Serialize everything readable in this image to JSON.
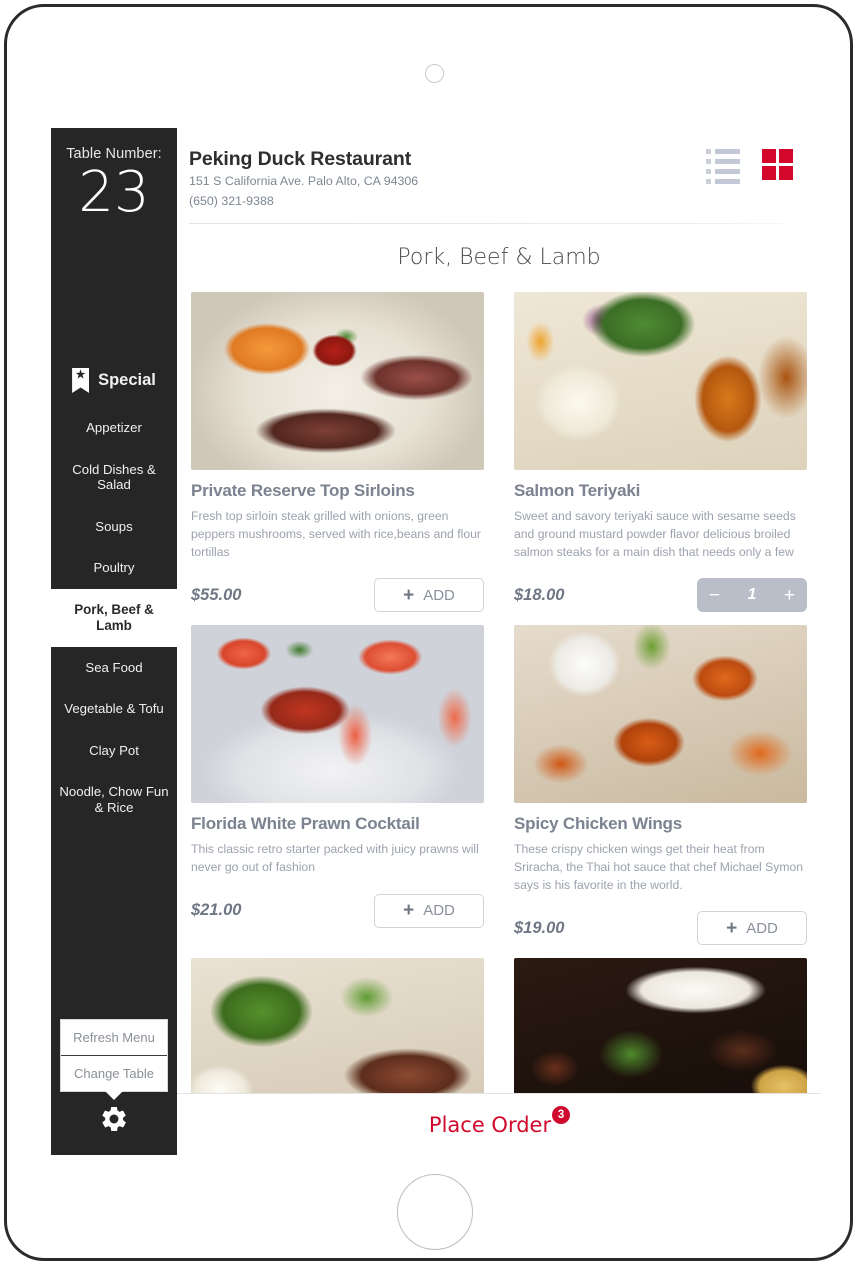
{
  "device": {
    "camera_icon": "camera-dot",
    "home_button_icon": "home-button"
  },
  "sidebar": {
    "table_label": "Table Number:",
    "table_number": "23",
    "special_icon": "ribbon-star-icon",
    "categories": [
      {
        "label": "Special",
        "active": false,
        "special": true
      },
      {
        "label": "Appetizer",
        "active": false
      },
      {
        "label": "Cold Dishes & Salad",
        "active": false
      },
      {
        "label": "Soups",
        "active": false
      },
      {
        "label": "Poultry",
        "active": false
      },
      {
        "label": "Pork, Beef & Lamb",
        "active": true
      },
      {
        "label": "Sea Food",
        "active": false
      },
      {
        "label": "Vegetable & Tofu",
        "active": false
      },
      {
        "label": "Clay Pot",
        "active": false
      },
      {
        "label": "Noodle, Chow Fun & Rice",
        "active": false
      }
    ],
    "footer": {
      "refresh_menu_label": "Refresh Menu",
      "change_table_label": "Change Table",
      "settings_icon": "gear-icon"
    }
  },
  "header": {
    "restaurant_name": "Peking Duck Restaurant",
    "address": "151 S California Ave. Palo Alto, CA 94306",
    "phone": "(650) 321-9388",
    "list_view_icon": "list-view-icon",
    "grid_view_icon": "grid-view-icon",
    "active_view": "grid",
    "accent_color": "#d3062b",
    "inactive_icon_color": "#c3c9d4"
  },
  "main": {
    "section_title": "Pork, Beef & Lamb",
    "items": [
      {
        "name": "Private Reserve Top Sirloins",
        "description": "Fresh top sirloin steak grilled with onions, green peppers mushrooms, served with rice,beans and flour tortillas",
        "price": "$55.00",
        "photo": "steak-with-sweet-potato",
        "control": "add",
        "add_label": "ADD",
        "plus_icon": "plus-icon"
      },
      {
        "name": "Salmon Teriyaki",
        "description": "Sweet and savory teriyaki sauce with sesame seeds and ground mustard powder flavor delicious broiled salmon steaks for a main dish that needs only a few",
        "price": "$18.00",
        "photo": "salmon-teriyaki-with-rice-and-salad",
        "control": "stepper",
        "quantity": "1",
        "minus_icon": "minus-icon",
        "plus_icon": "plus-icon"
      },
      {
        "name": "Florida White Prawn Cocktail",
        "description": "This classic retro starter packed with juicy prawns will never go out of fashion",
        "price": "$21.00",
        "photo": "prawn-cocktail-on-ice",
        "control": "add",
        "add_label": "ADD",
        "plus_icon": "plus-icon"
      },
      {
        "name": "Spicy Chicken Wings",
        "description": "These crispy chicken wings get their heat from Sriracha, the Thai hot sauce that chef Michael Symon says is his favorite in the world.",
        "price": "$19.00",
        "photo": "spicy-chicken-wings-with-dip",
        "control": "add",
        "add_label": "ADD",
        "plus_icon": "plus-icon"
      },
      {
        "name": "",
        "description": "",
        "price": "",
        "photo": "steak-with-broccoli",
        "control": "none"
      },
      {
        "name": "",
        "description": "",
        "price": "",
        "photo": "steak-with-fries-and-salad",
        "control": "none"
      }
    ]
  },
  "place_order": {
    "label": "Place Order",
    "badge_count": "3",
    "color": "#cf0a2c"
  }
}
